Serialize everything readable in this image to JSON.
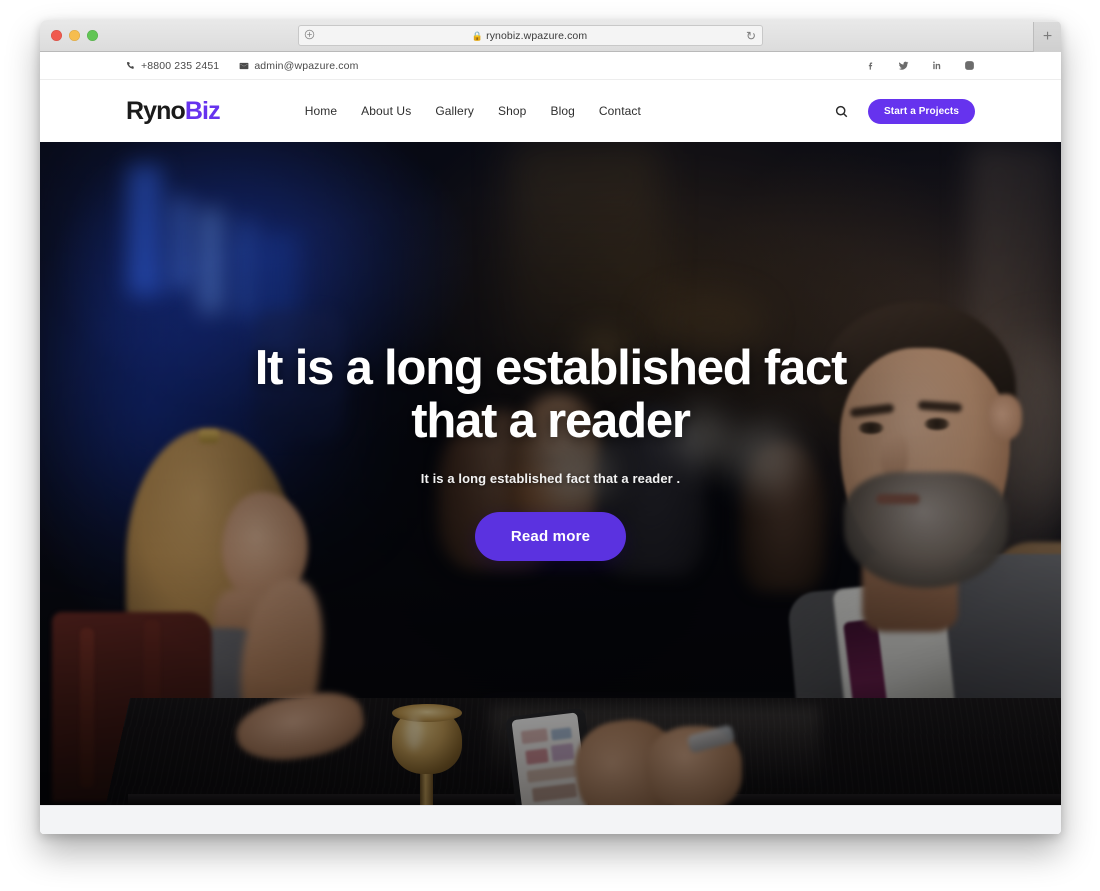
{
  "browser": {
    "url": "rynobiz.wpazure.com",
    "lock_icon": "lock-icon",
    "share_icon": "share-icon",
    "reload_icon": "reload-icon",
    "newtab_label": "+",
    "traffic_lights": [
      "close",
      "minimize",
      "zoom"
    ]
  },
  "topbar": {
    "phone": "+8800 235 2451",
    "email": "admin@wpazure.com",
    "phone_icon": "phone-icon",
    "email_icon": "envelope-icon",
    "social": [
      {
        "name": "facebook-icon",
        "label": "f"
      },
      {
        "name": "twitter-icon",
        "label": "t"
      },
      {
        "name": "linkedin-icon",
        "label": "in"
      },
      {
        "name": "instagram-icon",
        "label": "ig"
      }
    ]
  },
  "nav": {
    "logo_first": "Ryno",
    "logo_second": "Biz",
    "menu": [
      {
        "label": "Home"
      },
      {
        "label": "About Us"
      },
      {
        "label": "Gallery"
      },
      {
        "label": "Shop"
      },
      {
        "label": "Blog"
      },
      {
        "label": "Contact"
      }
    ],
    "search_icon": "search-icon",
    "cta_label": "Start a Projects"
  },
  "hero": {
    "title": "It is a long established fact that a reader",
    "subtitle": "It is a long established fact that a reader .",
    "button_label": "Read more"
  },
  "colors": {
    "brand_purple": "#6633ee",
    "cta_purple": "#5b32e0",
    "logo_dark": "#1b1b1b",
    "text_dark": "#2f2f2f",
    "topbar_text": "#4a4a4a",
    "hero_text": "#ffffff",
    "footer_strip": "#f3f4f6"
  }
}
